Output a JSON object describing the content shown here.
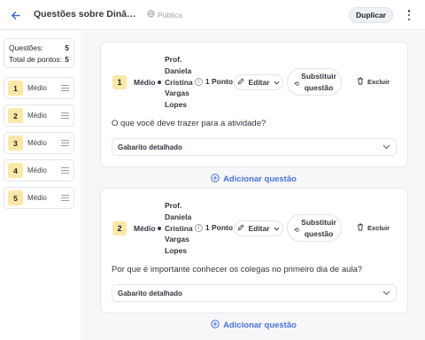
{
  "header": {
    "title": "Questões sobre Dinâmica de Apresentação",
    "visibility": "Pública",
    "duplicate_label": "Duplicar"
  },
  "sidebar": {
    "questions_label": "Questões:",
    "questions_count": "5",
    "points_label": "Total de pontos:",
    "points_count": "5",
    "items": [
      {
        "number": "1",
        "level": "Médio"
      },
      {
        "number": "2",
        "level": "Médio"
      },
      {
        "number": "3",
        "level": "Médio"
      },
      {
        "number": "4",
        "level": "Médio"
      },
      {
        "number": "5",
        "level": "Médio"
      }
    ]
  },
  "questions": [
    {
      "number": "1",
      "level": "Médio",
      "author": "Prof. Daniela Cristina Vargas Lopes",
      "points": "1 Ponto",
      "edit_label": "Editar",
      "replace_label": "Substituir questão",
      "delete_label": "Excluir",
      "prompt": "O que você deve trazer para a atividade?",
      "answer_label": "Gabarito detalhado"
    },
    {
      "number": "2",
      "level": "Médio",
      "author": "Prof. Daniela Cristina Vargas Lopes",
      "points": "1 Ponto",
      "edit_label": "Editar",
      "replace_label": "Substituir questão",
      "delete_label": "Excluir",
      "prompt": "Por que é importante conhecer os colegas no primeiro dia de aula?",
      "answer_label": "Gabarito detalhado"
    }
  ],
  "add_question_label": "Adicionar questão",
  "colors": {
    "accent": "#4a72d9",
    "badge": "#fbe7a6"
  }
}
